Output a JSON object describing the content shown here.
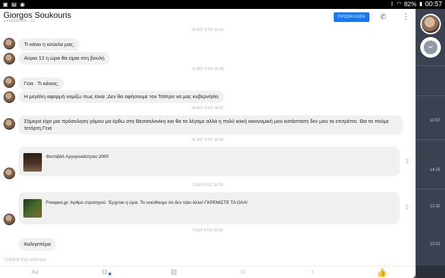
{
  "status_bar": {
    "left_icons": [
      "notification-icon",
      "gallery-icon",
      "messenger-icon"
    ],
    "right_icons": [
      "bluetooth-icon",
      "wifi-icon",
      "battery-icon"
    ],
    "battery": "82%",
    "time": "00:57"
  },
  "header": {
    "contact_name": "Giorgos Soukouris",
    "contact_subtitle": "● FACEBOOK · 2Ο",
    "call_button": "ΠΡΟΣΚΛΗΣΗ"
  },
  "messages": [
    {
      "type": "timestamp",
      "text": "26 ΑΥΓ ΣΤΙΣ 14:23"
    },
    {
      "type": "text",
      "text": "Τι κάνει η κούκλα μας;"
    },
    {
      "type": "text",
      "text": "Αύριο 12 η ώρα θα είμαι στη βουλή"
    },
    {
      "type": "timestamp",
      "text": "27 ΑΥΓ ΣΤΙΣ 14:09"
    },
    {
      "type": "text",
      "text": "Γεια . Τι κάνεις;"
    },
    {
      "type": "text",
      "text": "Η μεγάλη αφορμή νομίζω πως είναι ;Δεν θα αφήσουμε τον Τσίπρα να μας κυβερνήσει"
    },
    {
      "type": "timestamp",
      "text": "29 ΑΥΓ ΣΤΙΣ 08:37"
    },
    {
      "type": "text",
      "text": "Σήμερα είχα μια πρόσκληση γάμου μα έρθω στη Θεσσαλονίκη και θα τα λέγαμε αλλά η πολύ κακή οικονομική μου κατάσταση δεν μου το επιτρέπει. Θα τα πούμε τετάρτη.Γεια"
    },
    {
      "type": "timestamp",
      "text": "31 ΑΥΓ ΣΤΙΣ 19:50"
    },
    {
      "type": "link",
      "title": "Φεστιβάλ Αργυροκάστρου 2000"
    },
    {
      "type": "timestamp",
      "text": "3 ΣΕΠ ΣΤΙΣ 20:26"
    },
    {
      "type": "link",
      "title": "Freepen.gr: Άρθρο στρατηγού. 'Ερχεται η ώρα. Το νοιώθουμε ότι δεν πάει άλλο! ΓΚΡΕΜΙΣΤΕ ΤΑ ΟΛΑ!"
    },
    {
      "type": "timestamp",
      "text": "7 ΣΕΠ ΣΤΙΣ 20:35"
    },
    {
      "type": "text",
      "text": "Καλησπέρα"
    }
  ],
  "composer": {
    "placeholder": "Γράψτε ένα μήνυμα",
    "aa_label": "Aa",
    "tools": [
      "camera-icon",
      "image-icon",
      "emoji-icon",
      "microphone-icon",
      "thumbs-up-icon"
    ]
  },
  "background_app": {
    "numbers": [
      "10:57",
      "14:25",
      "12:32",
      "10:22"
    ]
  },
  "colors": {
    "accent": "#1877f2",
    "bubble": "#f1f0f0"
  }
}
